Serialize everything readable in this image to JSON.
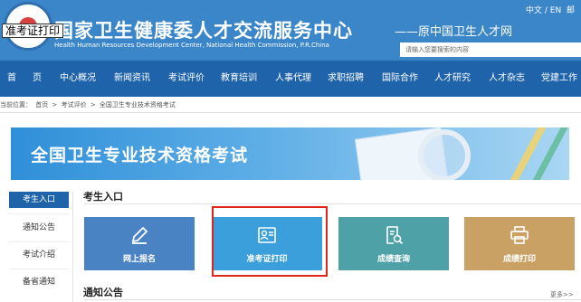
{
  "tooltip": "准考证打印",
  "header": {
    "title": "国家卫生健康委人才交流服务中心",
    "subtitle": "Health Human Resources Development Center, National Health Commission, P.R.China",
    "former_name": "——原中国卫生人才网",
    "lang": "中文 / EN",
    "lang_extra": "邮",
    "search_placeholder": "请输入您要搜索的内容"
  },
  "nav": {
    "items": [
      "首",
      "页",
      "中心概况",
      "新闻资讯",
      "考试评价",
      "教育培训",
      "人事代理",
      "求职招聘",
      "国际合作",
      "人才研究",
      "人才杂志",
      "党建工作"
    ]
  },
  "breadcrumb": {
    "items": [
      "当前位置：",
      "首页",
      ">",
      "考试评价",
      ">",
      "全国卫生专业技术资格考试"
    ]
  },
  "banner": {
    "title": "全国卫生专业技术资格考试"
  },
  "sidebar": {
    "items": [
      "考生入口",
      "通知公告",
      "考试介绍",
      "备省通知"
    ],
    "active_index": 0
  },
  "sections": {
    "entry_title": "考生入口",
    "notice_title": "通知公告",
    "more": "更多>>"
  },
  "cards": [
    {
      "label": "网上报名",
      "icon": "pencil-icon",
      "color": "#4a83c4"
    },
    {
      "label": "准考证打印",
      "icon": "id-card-icon",
      "color": "#3a9fda"
    },
    {
      "label": "成绩查询",
      "icon": "search-document-icon",
      "color": "#4fa1a8"
    },
    {
      "label": "成绩打印",
      "icon": "printer-icon",
      "color": "#c9a164"
    }
  ],
  "colors": {
    "header_bg": "#3b86c8",
    "nav_bg": "#1f64ab",
    "highlight": "#e1261c"
  }
}
